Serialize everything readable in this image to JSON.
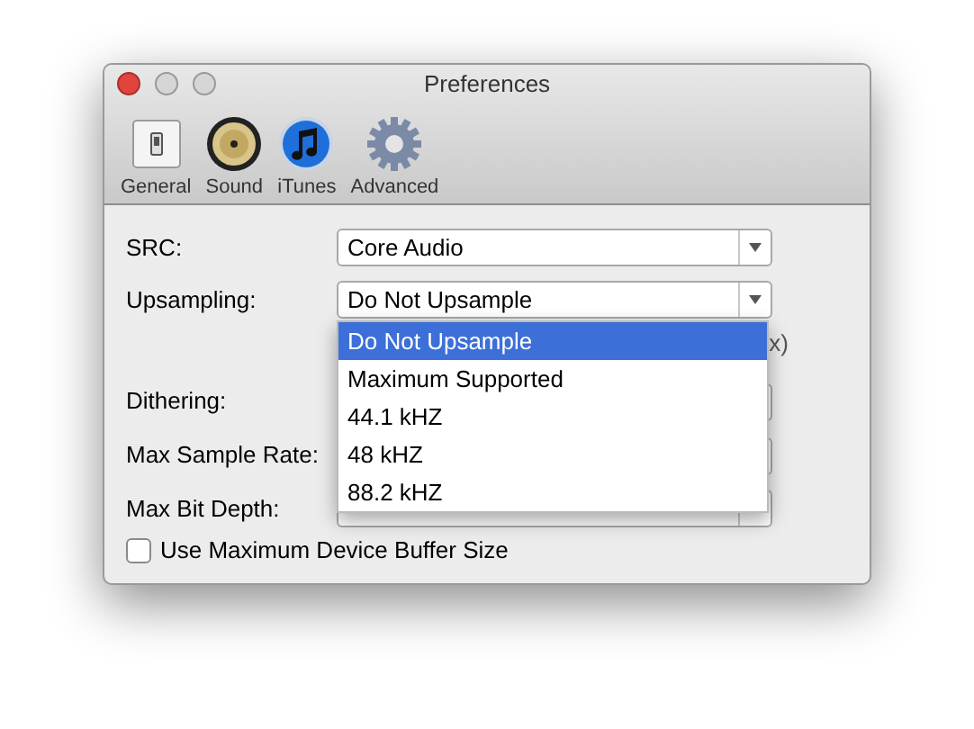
{
  "window": {
    "title": "Preferences"
  },
  "toolbar": [
    {
      "label": "General",
      "kind": "general"
    },
    {
      "label": "Sound",
      "kind": "sound"
    },
    {
      "label": "iTunes",
      "kind": "itunes"
    },
    {
      "label": "Advanced",
      "kind": "advanced"
    }
  ],
  "rows": [
    {
      "kind": "popup",
      "label": "SRC:",
      "value": "Core Audio"
    },
    {
      "kind": "popup",
      "label": "Upsampling:",
      "value": "Do Not Upsample"
    },
    {
      "kind": "note",
      "text": "x)"
    },
    {
      "kind": "popup",
      "label": "Dithering:"
    },
    {
      "kind": "popup",
      "label": "Max Sample Rate:"
    },
    {
      "kind": "popup",
      "label": "Max Bit Depth:"
    },
    {
      "kind": "checkbox",
      "label": "Use Maximum Device Buffer Size",
      "checked": false
    }
  ],
  "menu": [
    {
      "label": "Do Not Upsample",
      "selected": true
    },
    {
      "label": "Maximum Supported",
      "selected": false
    },
    {
      "label": "44.1 kHZ",
      "selected": false
    },
    {
      "label": "48 kHZ",
      "selected": false
    },
    {
      "label": "88.2 kHZ",
      "selected": false
    }
  ]
}
